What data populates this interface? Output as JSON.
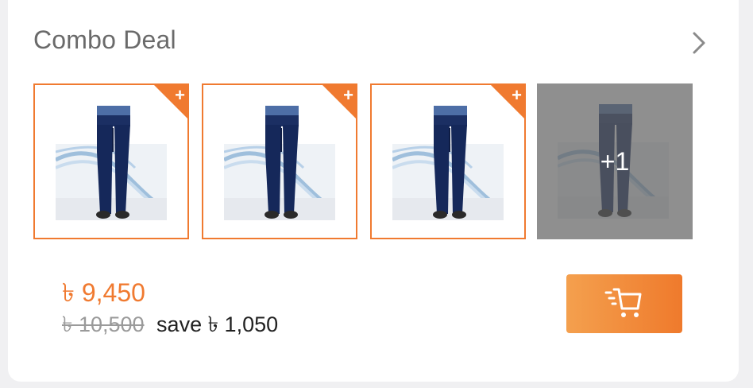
{
  "header": {
    "title": "Combo Deal",
    "chevron_icon": "chevron-right-icon"
  },
  "items": [
    {
      "image": "navy-trousers-thumbnail",
      "badge": "+"
    },
    {
      "image": "navy-trousers-thumbnail",
      "badge": "+"
    },
    {
      "image": "navy-trousers-thumbnail",
      "badge": "+"
    },
    {
      "image": "navy-trousers-thumbnail",
      "more_label": "+1"
    }
  ],
  "pricing": {
    "current": "৳ 9,450",
    "original": "৳ 10,500",
    "save_label": "save",
    "save_amount": "৳ 1,050"
  },
  "cart": {
    "icon": "add-to-cart-icon"
  },
  "colors": {
    "accent": "#f07a30",
    "button_gradient_start": "#f4a04e",
    "button_gradient_end": "#ef7a2c",
    "title_gray": "#6a6a6a",
    "strike_gray": "#9a9a9a"
  }
}
